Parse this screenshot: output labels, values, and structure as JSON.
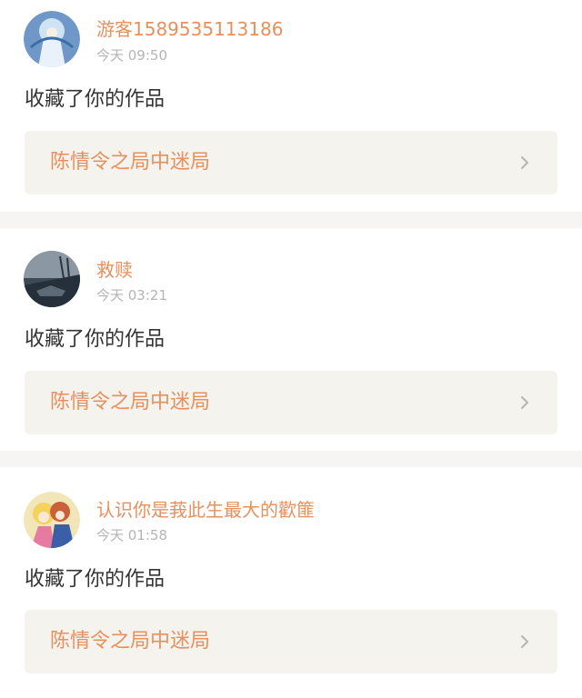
{
  "notifications": [
    {
      "username": "游客1589535113186",
      "time": "今天 09:50",
      "action": "收藏了你的作品",
      "work_title": "陈情令之局中迷局",
      "avatar_icon": "avatar-anime-figure-blue"
    },
    {
      "username": "救赎",
      "time": "今天 03:21",
      "action": "收藏了你的作品",
      "work_title": "陈情令之局中迷局",
      "avatar_icon": "avatar-dark-scenery"
    },
    {
      "username": "认识你是莪此生最大的歡篚",
      "time": "今天 01:58",
      "action": "收藏了你的作品",
      "work_title": "陈情令之局中迷局",
      "avatar_icon": "avatar-anime-couple"
    }
  ],
  "colors": {
    "accent": "#e8905d",
    "timestamp": "#b4b4b4",
    "text": "#333333",
    "work_card_bg": "#f4f3ee",
    "page_bg": "#f6f5f3"
  }
}
